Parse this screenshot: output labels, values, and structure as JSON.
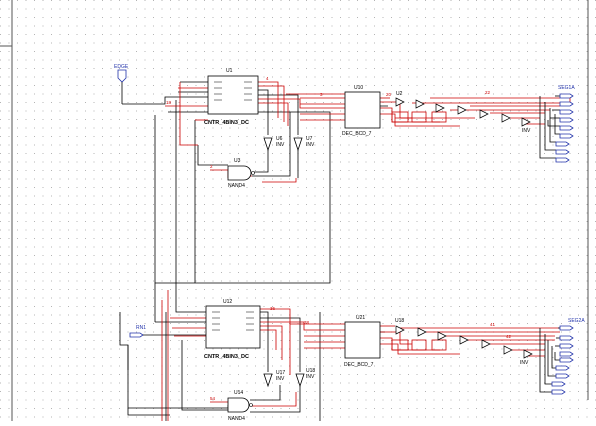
{
  "colors": {
    "background": "#ffffff",
    "grid_dot": "#b4b4b4",
    "border": "#555555",
    "wire_red": "#cc0000",
    "wire_black": "#000000",
    "port": "#2233aa",
    "component_text": "#000000",
    "net_label": "#cc0000"
  },
  "ports": {
    "in_top": "EDGE",
    "in_bottom": "RN1",
    "out_top_first": "SEG1A",
    "out_bottom_first": "SEG2A",
    "out_top_stubs": [
      "SEG1B",
      "SEG1C",
      "SEG1D",
      "SEG1E",
      "SEG1F",
      "SEG1G"
    ],
    "out_bottom_stubs": [
      "SEG2B",
      "SEG2C",
      "SEG2D",
      "SEG2E",
      "SEG2F",
      "SEG2G"
    ]
  },
  "components": {
    "top_counter": {
      "ref": "U1",
      "type": "CNTR_4BIN3_DC"
    },
    "top_decoder": {
      "ref": "U10",
      "type": "DEC_BCD_7"
    },
    "top_nand": {
      "ref": "U3",
      "type": "NAND4"
    },
    "top_inv_a": {
      "ref": "U6",
      "type": "INV"
    },
    "top_inv_b": {
      "ref": "U7",
      "type": "INV"
    },
    "top_chain_ref": "U2",
    "bottom_counter": {
      "ref": "U12",
      "type": "CNTR_4BIN3_DC"
    },
    "bottom_decoder": {
      "ref": "U21",
      "type": "DEC_BCD_7"
    },
    "bottom_nand": {
      "ref": "U14",
      "type": "NAND4"
    },
    "bottom_inv_a": {
      "ref": "U17",
      "type": "INV"
    },
    "bottom_inv_b": {
      "ref": "U18",
      "type": "INV"
    },
    "bottom_chain_ref": "U18",
    "inv_label": "INV"
  },
  "net_labels": {
    "n1": "3",
    "n2": "4",
    "n3": "2",
    "n4": "18",
    "n5": "20",
    "n6": "22",
    "n7": "54",
    "n8": "36",
    "n9": "38",
    "n10": "41",
    "n11": "42"
  }
}
